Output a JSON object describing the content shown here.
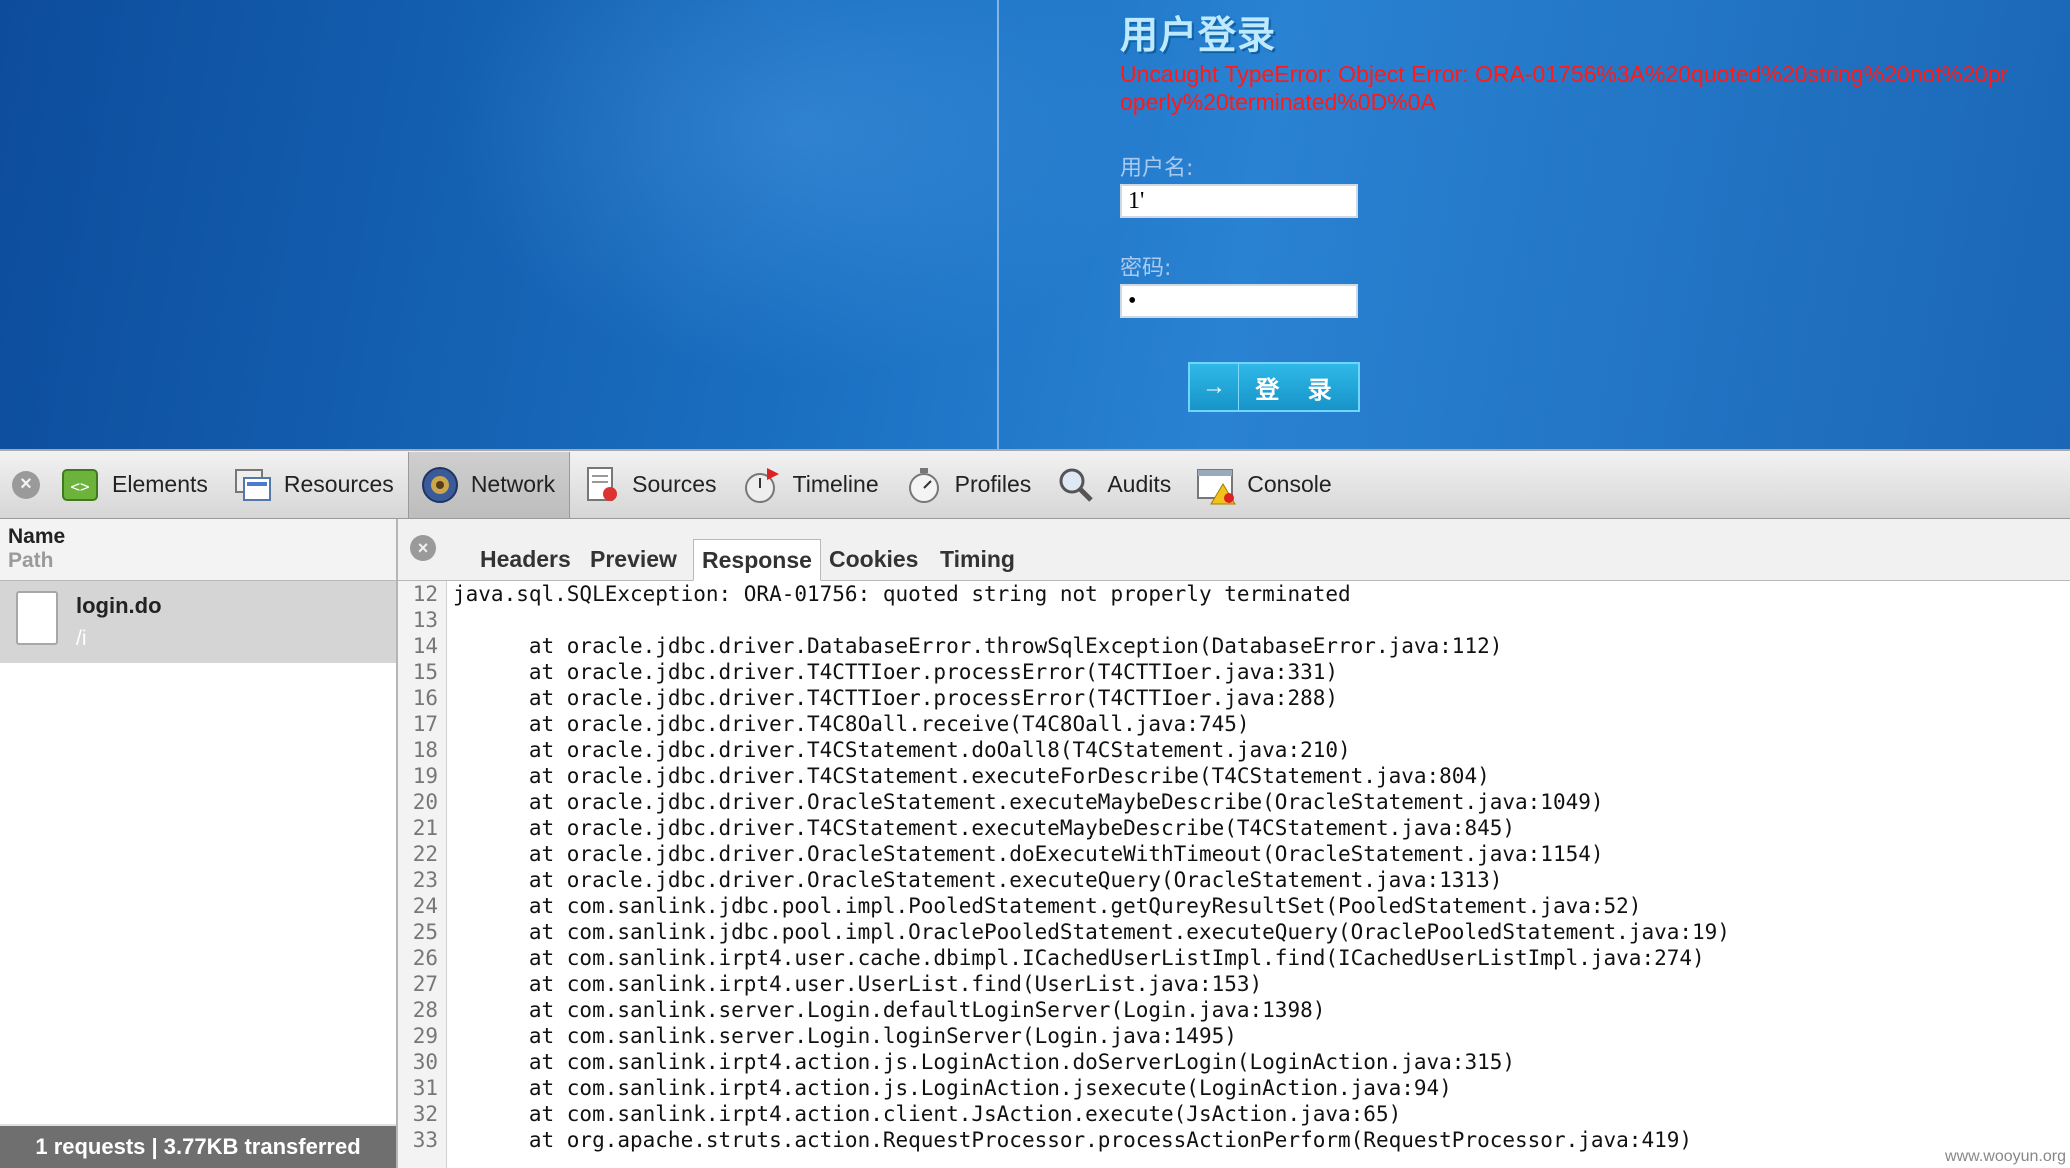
{
  "page": {
    "login_title": "用户登录",
    "error_message": "Uncaught TypeError: Object Error: ORA-01756%3A%20quoted%20string%20not%20properly%20terminated%0D%0A",
    "username_label": "用户名:",
    "username_value": "1'",
    "password_label": "密码:",
    "password_value": "•",
    "login_button_arrow": "→",
    "login_button_label": "登 录"
  },
  "toolbar": {
    "close_glyph": "×",
    "tabs": [
      {
        "label": "Elements",
        "icon": "elements-icon"
      },
      {
        "label": "Resources",
        "icon": "resources-icon"
      },
      {
        "label": "Network",
        "icon": "network-icon",
        "active": true
      },
      {
        "label": "Sources",
        "icon": "sources-icon"
      },
      {
        "label": "Timeline",
        "icon": "timeline-icon"
      },
      {
        "label": "Profiles",
        "icon": "profiles-icon"
      },
      {
        "label": "Audits",
        "icon": "audits-icon"
      },
      {
        "label": "Console",
        "icon": "console-icon"
      }
    ]
  },
  "request_list": {
    "name_header": "Name",
    "path_header": "Path",
    "items": [
      {
        "name": "login.do",
        "path": "/i"
      }
    ],
    "status": "1 requests  |  3.77KB transferred"
  },
  "detail": {
    "close_glyph": "×",
    "tabs": [
      "Headers",
      "Preview",
      "Response",
      "Cookies",
      "Timing"
    ],
    "active_tab": "Response",
    "lines": [
      {
        "n": "12",
        "t": "java.sql.SQLException: ORA-01756: quoted string not properly terminated"
      },
      {
        "n": "13",
        "t": ""
      },
      {
        "n": "14",
        "t": "      at oracle.jdbc.driver.DatabaseError.throwSqlException(DatabaseError.java:112)"
      },
      {
        "n": "15",
        "t": "      at oracle.jdbc.driver.T4CTTIoer.processError(T4CTTIoer.java:331)"
      },
      {
        "n": "16",
        "t": "      at oracle.jdbc.driver.T4CTTIoer.processError(T4CTTIoer.java:288)"
      },
      {
        "n": "17",
        "t": "      at oracle.jdbc.driver.T4C8Oall.receive(T4C8Oall.java:745)"
      },
      {
        "n": "18",
        "t": "      at oracle.jdbc.driver.T4CStatement.doOall8(T4CStatement.java:210)"
      },
      {
        "n": "19",
        "t": "      at oracle.jdbc.driver.T4CStatement.executeForDescribe(T4CStatement.java:804)"
      },
      {
        "n": "20",
        "t": "      at oracle.jdbc.driver.OracleStatement.executeMaybeDescribe(OracleStatement.java:1049)"
      },
      {
        "n": "21",
        "t": "      at oracle.jdbc.driver.T4CStatement.executeMaybeDescribe(T4CStatement.java:845)"
      },
      {
        "n": "22",
        "t": "      at oracle.jdbc.driver.OracleStatement.doExecuteWithTimeout(OracleStatement.java:1154)"
      },
      {
        "n": "23",
        "t": "      at oracle.jdbc.driver.OracleStatement.executeQuery(OracleStatement.java:1313)"
      },
      {
        "n": "24",
        "t": "      at com.sanlink.jdbc.pool.impl.PooledStatement.getQureyResultSet(PooledStatement.java:52)"
      },
      {
        "n": "25",
        "t": "      at com.sanlink.jdbc.pool.impl.OraclePooledStatement.executeQuery(OraclePooledStatement.java:19)"
      },
      {
        "n": "26",
        "t": "      at com.sanlink.irpt4.user.cache.dbimpl.ICachedUserListImpl.find(ICachedUserListImpl.java:274)"
      },
      {
        "n": "27",
        "t": "      at com.sanlink.irpt4.user.UserList.find(UserList.java:153)"
      },
      {
        "n": "28",
        "t": "      at com.sanlink.server.Login.defaultLoginServer(Login.java:1398)"
      },
      {
        "n": "29",
        "t": "      at com.sanlink.server.Login.loginServer(Login.java:1495)"
      },
      {
        "n": "30",
        "t": "      at com.sanlink.irpt4.action.js.LoginAction.doServerLogin(LoginAction.java:315)"
      },
      {
        "n": "31",
        "t": "      at com.sanlink.irpt4.action.js.LoginAction.jsexecute(LoginAction.java:94)"
      },
      {
        "n": "32",
        "t": "      at com.sanlink.irpt4.action.client.JsAction.execute(JsAction.java:65)"
      },
      {
        "n": "33",
        "t": "      at org.apache.struts.action.RequestProcessor.processActionPerform(RequestProcessor.java:419)"
      }
    ]
  },
  "watermark": "www.wooyun.org"
}
